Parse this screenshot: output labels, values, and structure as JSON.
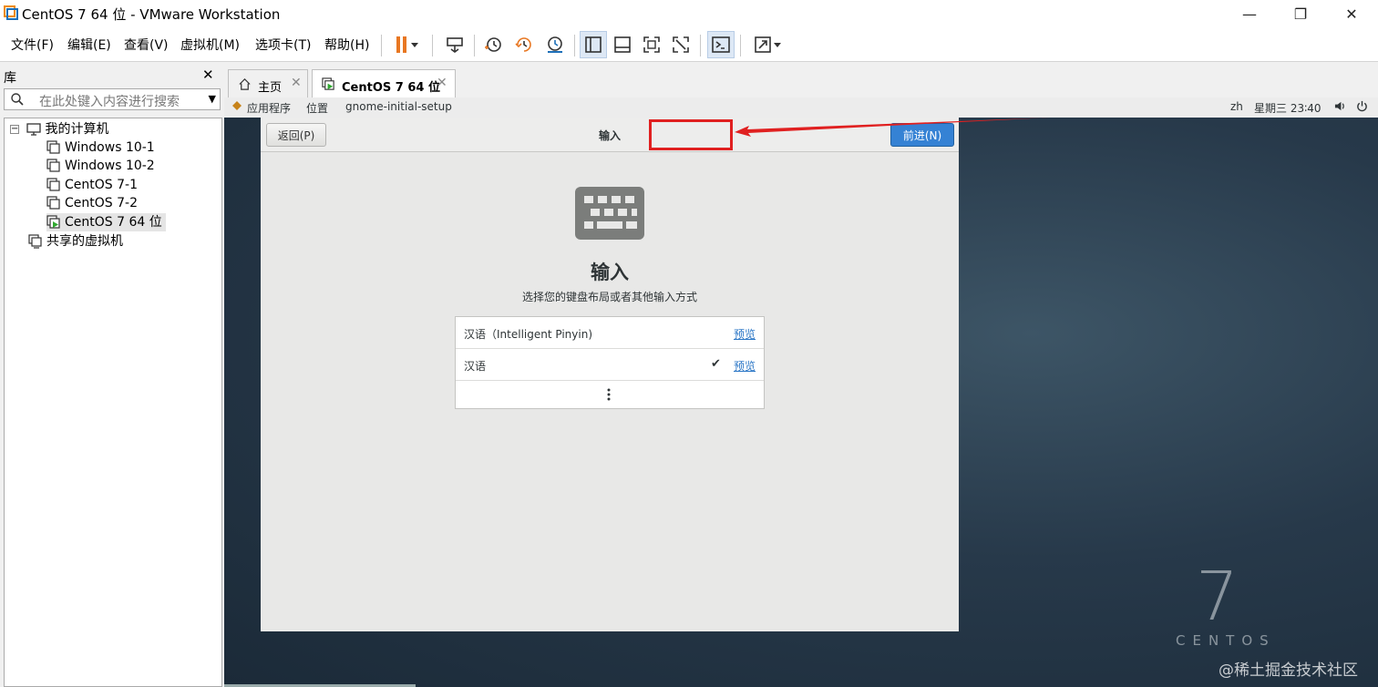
{
  "window": {
    "title": "CentOS 7 64 位 - VMware Workstation",
    "controls": {
      "minimize": "—",
      "restore": "❐",
      "close": "✕"
    }
  },
  "menu": [
    "文件(F)",
    "编辑(E)",
    "查看(V)",
    "虚拟机(M)",
    "选项卡(T)",
    "帮助(H)"
  ],
  "library": {
    "title": "库",
    "close": "✕",
    "search_placeholder": "在此处键入内容进行搜索",
    "tree": {
      "root": "我的计算机",
      "vms": [
        "Windows 10-1",
        "Windows 10-2",
        "CentOS 7-1",
        "CentOS 7-2",
        "CentOS 7 64 位"
      ],
      "shared": "共享的虚拟机"
    }
  },
  "tabs": [
    {
      "label": "主页",
      "icon": "home-icon"
    },
    {
      "label": "CentOS 7 64 位",
      "icon": "vm-running-icon"
    }
  ],
  "gnome_bar": {
    "apps": "应用程序",
    "places": "位置",
    "app_name": "gnome-initial-setup",
    "lang": "zh",
    "clock": "星期三 23∶40"
  },
  "dialog": {
    "back": "返回(P)",
    "title": "输入",
    "next": "前进(N)",
    "heading": "输入",
    "subtitle": "选择您的键盘布局或者其他输入方式",
    "inputs": [
      {
        "name": "汉语（Intelligent Pinyin)",
        "preview": "预览",
        "checked": false
      },
      {
        "name": "汉语",
        "preview": "预览",
        "checked": true
      }
    ],
    "more": "⋮"
  },
  "branding": {
    "centos_number": "7",
    "centos_word": "CENTOS",
    "watermark": "@稀土掘金技术社区"
  },
  "colors": {
    "next_button": "#3582d4",
    "highlight": "#e02020",
    "link": "#2a76c6",
    "pause": "#e87722"
  }
}
